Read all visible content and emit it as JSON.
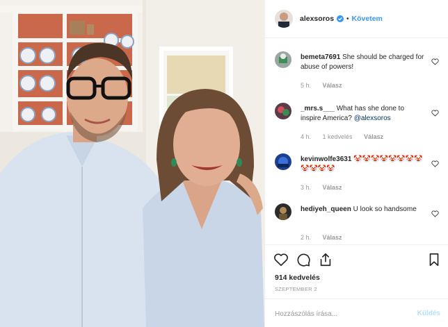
{
  "header": {
    "username": "alexsoros",
    "separator": "•",
    "follow_label": "Követem"
  },
  "comments": [
    {
      "username": "bemeta7691",
      "text": "She should be charged for abuse of powers!",
      "time": "5 h.",
      "likes": "",
      "reply": "Válasz"
    },
    {
      "username": "_mrs.s___",
      "text": "What has she done to inspire America?",
      "mention": "@alexsoros",
      "time": "4 h.",
      "likes": "1 kedvelés",
      "reply": "Válasz"
    },
    {
      "username": "kevinwolfe3631",
      "text": "🤡🤡🤡🤡🤡🤡🤡🤡🤡🤡🤡🤡",
      "time": "3 h.",
      "likes": "",
      "reply": "Válasz"
    },
    {
      "username": "hediyeh_queen",
      "text": "U look so handsome",
      "time": "2 h.",
      "likes": "",
      "reply": "Válasz"
    }
  ],
  "actions": {
    "like_icon": "heart-outline-icon",
    "comment_icon": "comment-bubble-icon",
    "share_icon": "share-upload-icon",
    "save_icon": "bookmark-icon"
  },
  "likes_count": "914 kedvelés",
  "date": "SZEPTEMBER 2",
  "composer": {
    "placeholder": "Hozzászólás írása...",
    "post_label": "Küldés"
  },
  "colors": {
    "link_blue": "#3897f0",
    "post_disabled": "#b2dffc",
    "meta_gray": "#999999",
    "border": "#efefef"
  }
}
